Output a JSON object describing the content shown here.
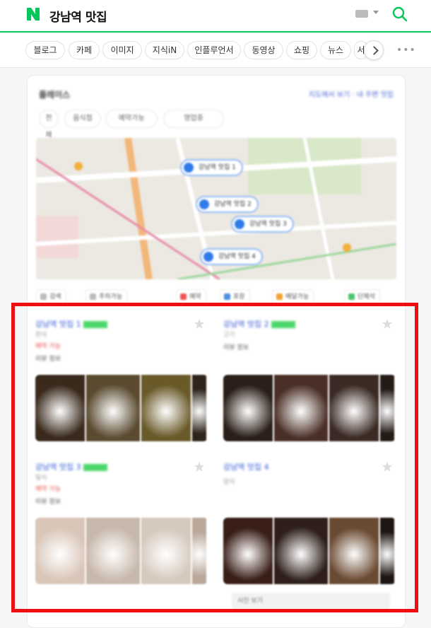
{
  "search": {
    "logo": "N",
    "query": "강남역 맛집",
    "brand_color": "#03c75a",
    "icons": [
      "keyboard-icon",
      "chevron-down-icon",
      "search-icon"
    ]
  },
  "tabs": [
    "블로그",
    "카페",
    "이미지",
    "지식iN",
    "인플루언서",
    "동영상",
    "쇼핑",
    "뉴스",
    "서"
  ],
  "place": {
    "title": "플레이스",
    "meta": "지도에서 보기 · 내 주변 맛집",
    "chips": [
      "전체",
      "음식점",
      "예약가능",
      "영업중"
    ],
    "map_pins": [
      "강남역 맛집 1",
      "강남역 맛집 2",
      "강남역 맛집 3",
      "강남역 맛집 4"
    ],
    "filters": [
      "검색",
      "주차가능",
      "예약",
      "포장",
      "배달가능",
      "단체석"
    ]
  },
  "results": [
    {
      "name": "강남역 맛집 1",
      "category": "한식",
      "promo": "예약 가능",
      "desc": "리뷰 정보",
      "photo_colors": [
        "#3a2a1c",
        "#5a4a30",
        "#6a5a2a",
        "#2e241a"
      ]
    },
    {
      "name": "강남역 맛집 2",
      "category": "고기",
      "promo": "",
      "desc": "리뷰 정보",
      "photo_colors": [
        "#2b1f19",
        "#4a2f26",
        "#3b2a24",
        "#241a16"
      ]
    },
    {
      "name": "강남역 맛집 3",
      "category": "일식",
      "promo": "예약 가능",
      "desc": "리뷰 정보",
      "photo_colors": [
        "#d9c6b8",
        "#c8b8ab",
        "#d6c9bd",
        "#b9a79a"
      ]
    },
    {
      "name": "강남역 맛집 4",
      "category": "양식",
      "promo": "",
      "desc": "리뷰 정보",
      "photo_colors": [
        "#3a1f18",
        "#2e1f1a",
        "#6a4a32",
        "#1e1612"
      ]
    }
  ],
  "result_footer": "사진 보기",
  "highlight_color": "#ee1010"
}
